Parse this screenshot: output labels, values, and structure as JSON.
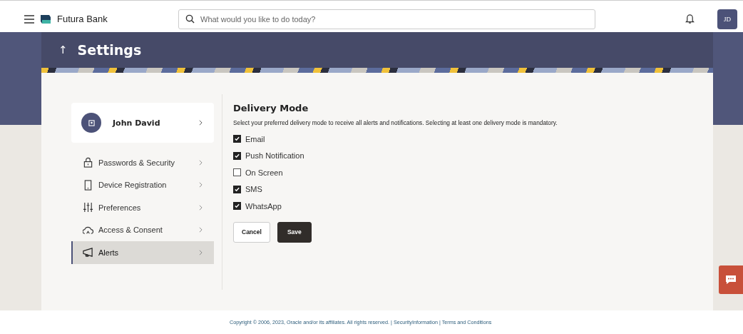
{
  "header": {
    "brand": "Futura Bank",
    "search_placeholder": "What would you like to do today?",
    "avatar": "JD"
  },
  "page": {
    "title": "Settings",
    "back_icon": "↑"
  },
  "profile": {
    "name": "John David"
  },
  "menu": [
    {
      "label": "Passwords & Security",
      "selected": false
    },
    {
      "label": "Device Registration",
      "selected": false
    },
    {
      "label": "Preferences",
      "selected": false
    },
    {
      "label": "Access & Consent",
      "selected": false
    },
    {
      "label": "Alerts",
      "selected": true
    }
  ],
  "delivery": {
    "title": "Delivery Mode",
    "description": "Select your preferred delivery mode to receive all alerts and notifications. Selecting at least one delivery mode is mandatory.",
    "options": [
      {
        "label": "Email",
        "checked": true
      },
      {
        "label": "Push Notification",
        "checked": true
      },
      {
        "label": "On Screen",
        "checked": false
      },
      {
        "label": "SMS",
        "checked": true
      },
      {
        "label": "WhatsApp",
        "checked": true
      }
    ],
    "buttons": [
      {
        "label": "Cancel",
        "kind": "secondary"
      },
      {
        "label": "Save",
        "kind": "primary"
      }
    ]
  },
  "footer": {
    "copyright": "Copyright © 2006, 2023, Oracle and/or its affiliates. All rights reserved.",
    "separator": "|",
    "links": [
      "SecurityInformation",
      "Terms and Conditions"
    ]
  }
}
